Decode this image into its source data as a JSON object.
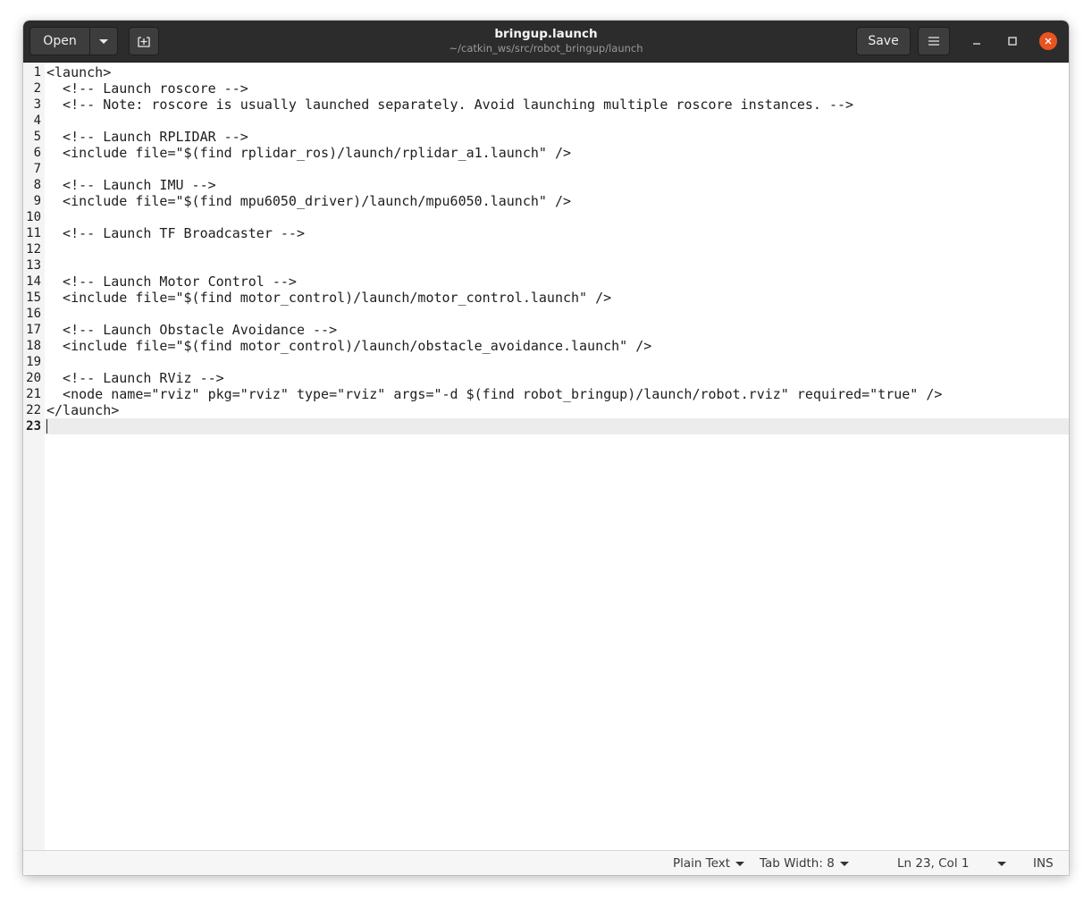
{
  "window": {
    "title": "bringup.launch",
    "subtitle": "~/catkin_ws/src/robot_bringup/launch"
  },
  "headerbar": {
    "open_label": "Open",
    "save_label": "Save"
  },
  "icons": {
    "open_menu": "chevron-down-icon",
    "new_tab": "new-tab-icon",
    "menu": "hamburger-menu-icon",
    "minimize": "minimize-icon",
    "maximize": "maximize-icon",
    "close": "close-icon"
  },
  "colors": {
    "headerbar_bg": "#2c2c2c",
    "close_button": "#e95420",
    "current_line": "#ececec"
  },
  "editor": {
    "current_line": 23,
    "lines": [
      {
        "n": "1",
        "text": "<launch>"
      },
      {
        "n": "2",
        "text": "  <!-- Launch roscore -->"
      },
      {
        "n": "3",
        "text": "  <!-- Note: roscore is usually launched separately. Avoid launching multiple roscore instances. -->"
      },
      {
        "n": "4",
        "text": ""
      },
      {
        "n": "5",
        "text": "  <!-- Launch RPLIDAR -->"
      },
      {
        "n": "6",
        "text": "  <include file=\"$(find rplidar_ros)/launch/rplidar_a1.launch\" />"
      },
      {
        "n": "7",
        "text": ""
      },
      {
        "n": "8",
        "text": "  <!-- Launch IMU -->"
      },
      {
        "n": "9",
        "text": "  <include file=\"$(find mpu6050_driver)/launch/mpu6050.launch\" />"
      },
      {
        "n": "10",
        "text": ""
      },
      {
        "n": "11",
        "text": "  <!-- Launch TF Broadcaster -->"
      },
      {
        "n": "12",
        "text": ""
      },
      {
        "n": "13",
        "text": ""
      },
      {
        "n": "14",
        "text": "  <!-- Launch Motor Control -->"
      },
      {
        "n": "15",
        "text": "  <include file=\"$(find motor_control)/launch/motor_control.launch\" />"
      },
      {
        "n": "16",
        "text": ""
      },
      {
        "n": "17",
        "text": "  <!-- Launch Obstacle Avoidance -->"
      },
      {
        "n": "18",
        "text": "  <include file=\"$(find motor_control)/launch/obstacle_avoidance.launch\" />"
      },
      {
        "n": "19",
        "text": ""
      },
      {
        "n": "20",
        "text": "  <!-- Launch RViz -->"
      },
      {
        "n": "21",
        "text": "  <node name=\"rviz\" pkg=\"rviz\" type=\"rviz\" args=\"-d $(find robot_bringup)/launch/robot.rviz\" required=\"true\" />"
      },
      {
        "n": "22",
        "text": "</launch>"
      },
      {
        "n": "23",
        "text": ""
      }
    ]
  },
  "statusbar": {
    "language": "Plain Text",
    "tab_width": "Tab Width: 8",
    "position": "Ln 23, Col 1",
    "mode": "INS"
  }
}
